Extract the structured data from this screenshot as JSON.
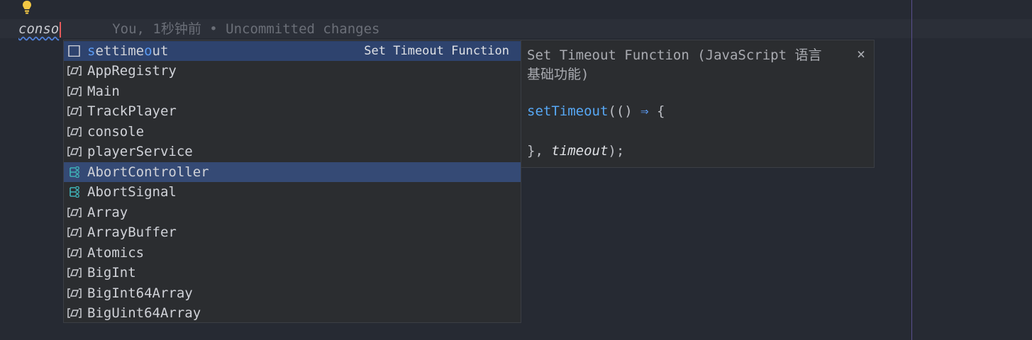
{
  "editor": {
    "typed_text": "conso",
    "blame_text": "You, 1秒钟前 • Uncommitted changes"
  },
  "completion": {
    "items": [
      {
        "label_match_1": "s",
        "label_mid": "ettime",
        "label_match_2": "o",
        "label_end": "ut",
        "hint": "Set Timeout Function",
        "icon": "template-icon",
        "state": "selected"
      },
      {
        "label": "AppRegistry",
        "icon": "variable-icon"
      },
      {
        "label": "Main",
        "icon": "variable-icon"
      },
      {
        "label": "TrackPlayer",
        "icon": "variable-icon"
      },
      {
        "label": "console",
        "icon": "variable-icon"
      },
      {
        "label": "playerService",
        "icon": "variable-icon"
      },
      {
        "label": "AbortController",
        "icon": "class-icon",
        "state": "hovered"
      },
      {
        "label": "AbortSignal",
        "icon": "class-icon"
      },
      {
        "label": "Array",
        "icon": "variable-icon"
      },
      {
        "label": "ArrayBuffer",
        "icon": "variable-icon"
      },
      {
        "label": "Atomics",
        "icon": "variable-icon"
      },
      {
        "label": "BigInt",
        "icon": "variable-icon"
      },
      {
        "label": "BigInt64Array",
        "icon": "variable-icon"
      },
      {
        "label": "BigUint64Array",
        "icon": "variable-icon"
      }
    ]
  },
  "documentation": {
    "title": "Set Timeout Function (JavaScript 语言基础功能)",
    "close_icon": "×",
    "code_fn": "setTimeout",
    "code_open_a": "(() ",
    "code_arrow": "⇒",
    "code_open_b": " {",
    "code_close_a": "}, ",
    "code_param": "timeout",
    "code_close_b": ");"
  },
  "colors": {
    "background": "#262a33",
    "popup": "#2b2d30",
    "selection": "#2e436e",
    "match": "#5c9cf5",
    "class_icon": "#3fb3b8"
  }
}
